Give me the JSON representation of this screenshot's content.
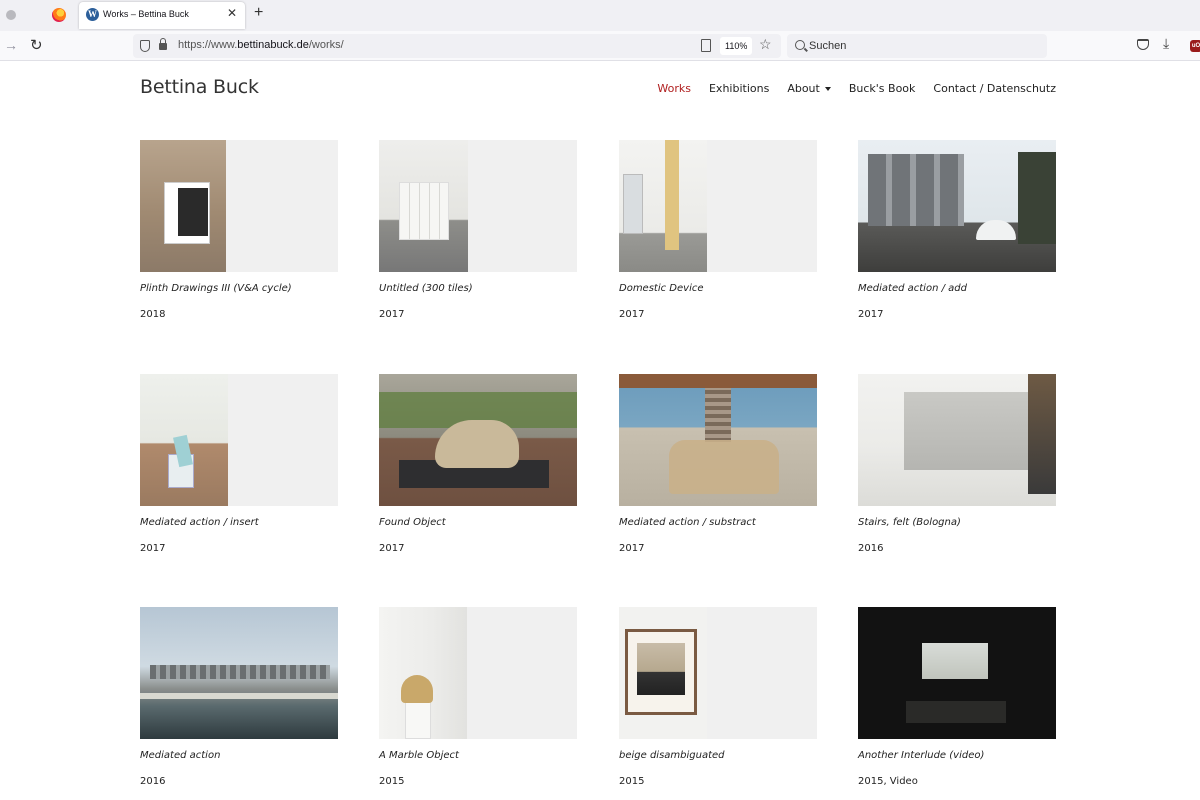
{
  "browser": {
    "tab_title": "Works – Bettina Buck",
    "url_prefix": "https://www.",
    "url_domain": "bettinabuck.de",
    "url_path": "/works/",
    "zoom": "110%",
    "search_placeholder": "Suchen"
  },
  "site": {
    "title": "Bettina Buck",
    "nav": [
      {
        "label": "Works",
        "active": true
      },
      {
        "label": "Exhibitions"
      },
      {
        "label": "About"
      },
      {
        "label": "Buck's Book"
      },
      {
        "label": "Contact / Datenschutz"
      }
    ]
  },
  "works": [
    {
      "title": "Plinth Drawings III (V&A cycle)",
      "year": "2018"
    },
    {
      "title": "Untitled (300 tiles)",
      "year": "2017"
    },
    {
      "title": "Domestic Device",
      "year": "2017"
    },
    {
      "title": "Mediated action / add",
      "year": "2017"
    },
    {
      "title": "Mediated action / insert",
      "year": "2017"
    },
    {
      "title": "Found Object",
      "year": "2017"
    },
    {
      "title": "Mediated action / substract",
      "year": "2017"
    },
    {
      "title": "Stairs, felt (Bologna)",
      "year": "2016"
    },
    {
      "title": "Mediated action",
      "year": "2016"
    },
    {
      "title": "A Marble Object",
      "year": "2015"
    },
    {
      "title": "beige disambiguated",
      "year": "2015"
    },
    {
      "title": "Another Interlude (video)",
      "year": "2015, Video"
    }
  ]
}
